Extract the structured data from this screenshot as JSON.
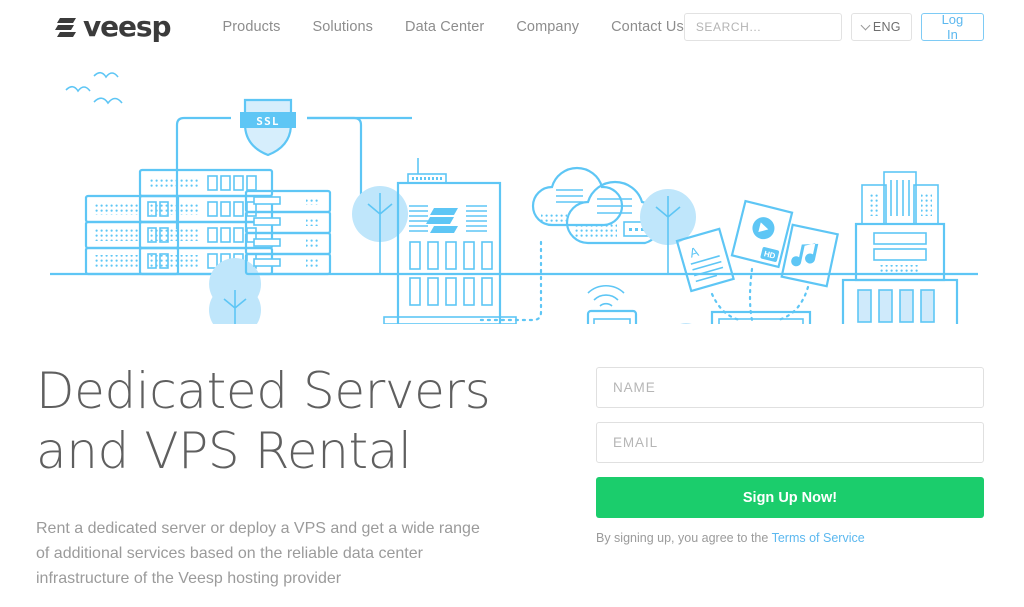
{
  "brand": {
    "name": "veesp",
    "logo_icon": "veesp-bars-logo",
    "accent_blue": "#5cb8ef",
    "illustration_blue": "#5ec6f5",
    "illustration_fill": "#bfe6fb",
    "green": "#1bcd6c",
    "text_gray": "#5f5f5f",
    "muted_gray": "#9b9b9b"
  },
  "header": {
    "nav": [
      {
        "label": "Products"
      },
      {
        "label": "Solutions"
      },
      {
        "label": "Data Center"
      },
      {
        "label": "Company"
      },
      {
        "label": "Contact Us"
      }
    ],
    "search": {
      "placeholder": "SEARCH...",
      "value": "",
      "icon": "search-icon"
    },
    "language": {
      "label": "ENG",
      "icon": "chevron-down-icon"
    },
    "login_label": "Log In"
  },
  "illustration": {
    "alt": "data center city illustration",
    "ssl_badge_label": "SSL",
    "video_card_label": "HD",
    "document_card_label": "A",
    "elements": [
      "birds",
      "ssl-shield",
      "server-racks",
      "trees",
      "datacenter-building",
      "clouds",
      "wifi-signal",
      "tablet",
      "phone",
      "laptop",
      "document-card",
      "video-card",
      "music-card",
      "office-building"
    ]
  },
  "hero": {
    "headline_line1": "Dedicated Servers",
    "headline_line2": "and VPS Rental",
    "subcopy": "Rent a dedicated server or deploy a VPS and get a wide range of additional services based on the reliable data center infrastructure of the Veesp hosting provider"
  },
  "signup": {
    "name_placeholder": "NAME",
    "name_value": "",
    "email_placeholder": "EMAIL",
    "email_value": "",
    "button_label": "Sign Up Now!",
    "terms_prefix": "By signing up, you agree to the ",
    "terms_link_label": "Terms of Service"
  }
}
